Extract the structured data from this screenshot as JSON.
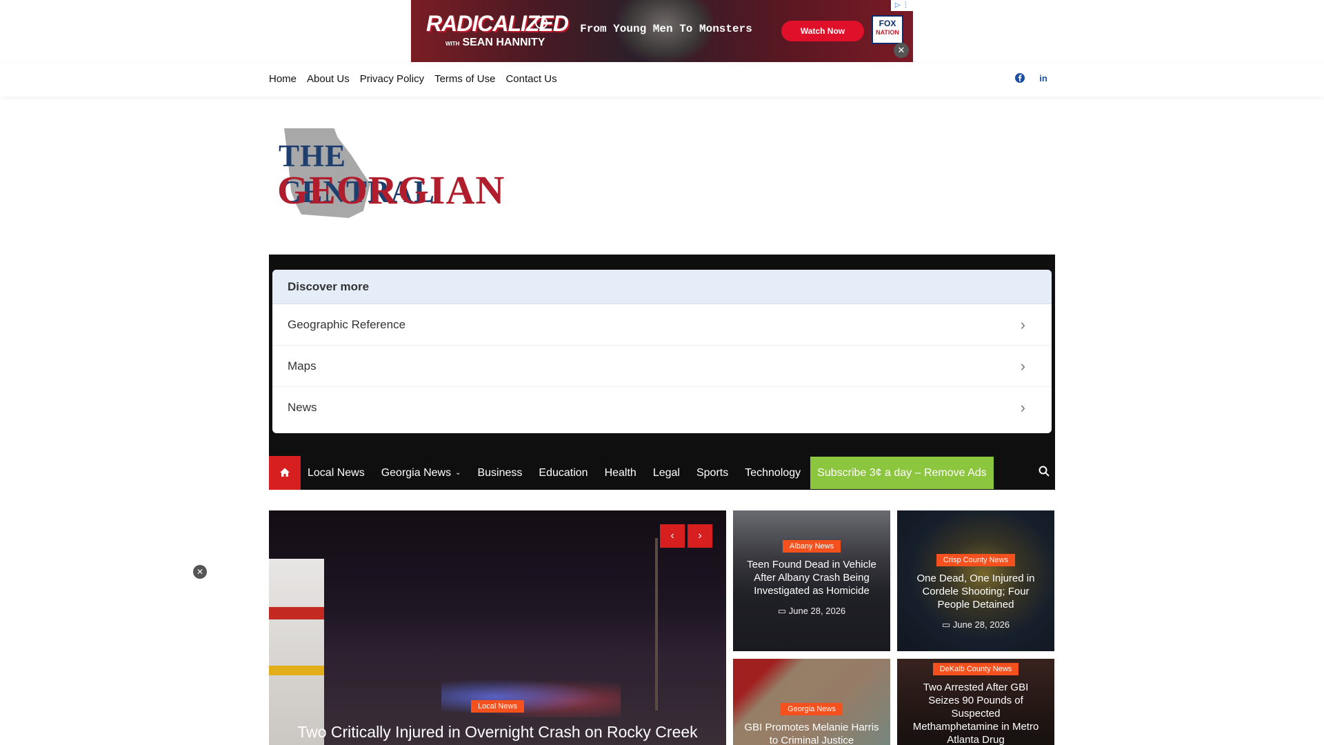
{
  "ad": {
    "brand": "RADICALIZED",
    "brand_sub_prefix": "WITH",
    "brand_sub": "SEAN HANNITY",
    "tagline": "From Young Men To Monsters",
    "cta": "Watch Now",
    "network_logo_top": "FOX",
    "network_logo_bottom": "NATION",
    "choices": "▷ ⋮",
    "close": "✕"
  },
  "topnav": {
    "items": [
      "Home",
      "About Us",
      "Privacy Policy",
      "Terms of Use",
      "Contact Us"
    ],
    "social": [
      "facebook-icon",
      "linkedin-icon"
    ]
  },
  "logo": {
    "line1": "THE CENTRAL",
    "line2": "GEORGIAN"
  },
  "discover": {
    "heading": "Discover more",
    "items": [
      "Geographic Reference",
      "Maps",
      "News"
    ]
  },
  "mainnav": {
    "items": [
      "Local News",
      "Georgia News",
      "Business",
      "Education",
      "Health",
      "Legal",
      "Sports",
      "Technology"
    ],
    "dropdown_caret": "⌄",
    "subscribe": "Subscribe 3¢ a day – Remove Ads",
    "accent_red": "#d81f1f",
    "accent_green": "#8cc63f"
  },
  "featured": {
    "category": "Local News",
    "title": "Two Critically Injured in Overnight Crash on Rocky Creek",
    "prev": "‹",
    "next": "›"
  },
  "cards": [
    {
      "category": "Albany News",
      "title": "Teen Found Dead in Vehicle After Albany Crash Being Investigated as Homicide",
      "date": "June 28, 2026"
    },
    {
      "category": "Crisp County News",
      "title": "One Dead, One Injured in Cordele Shooting; Four People Detained",
      "date": "June 28, 2026"
    },
    {
      "category": "Georgia News",
      "title": "GBI Promotes Melanie Harris to Criminal Justice"
    },
    {
      "category": "DeKalb County News",
      "title": "Two Arrested After GBI Seizes 90 Pounds of Suspected Methamphetamine in Metro Atlanta Drug"
    }
  ],
  "floating_close": "✕",
  "badge_color": "#f4511e"
}
